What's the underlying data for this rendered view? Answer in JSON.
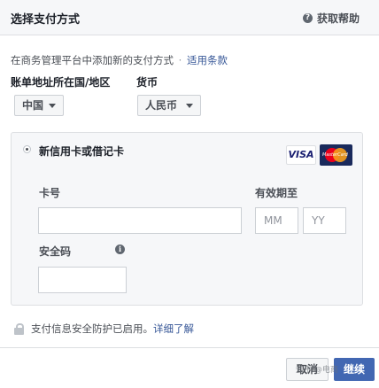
{
  "dialog": {
    "title": "选择支付方式",
    "help_label": "获取帮助"
  },
  "intro": {
    "text": "在商务管理平台中添加新的支付方式",
    "separator": "·",
    "terms_link": "适用条款"
  },
  "billing": {
    "country_label": "账单地址所在国/地区",
    "country_value": "中国",
    "currency_label": "货币",
    "currency_value": "人民币"
  },
  "card": {
    "option_label": "新信用卡或借记卡",
    "selected": true,
    "brands": [
      "VISA",
      "MasterCard"
    ],
    "number_label": "卡号",
    "number_value": "",
    "expiry_label": "有效期至",
    "month_placeholder": "MM",
    "year_placeholder": "YY",
    "cvv_label": "安全码",
    "cvv_value": ""
  },
  "security": {
    "text": "支付信息安全防护已启用。",
    "link": "详细了解"
  },
  "footer": {
    "cancel_label": "取消",
    "next_label": "继续"
  },
  "watermark": "知乎 @电商",
  "colors": {
    "link": "#385898",
    "primary_button": "#4267b2",
    "header_bg": "#f6f7f9",
    "border": "#dddfe2"
  }
}
